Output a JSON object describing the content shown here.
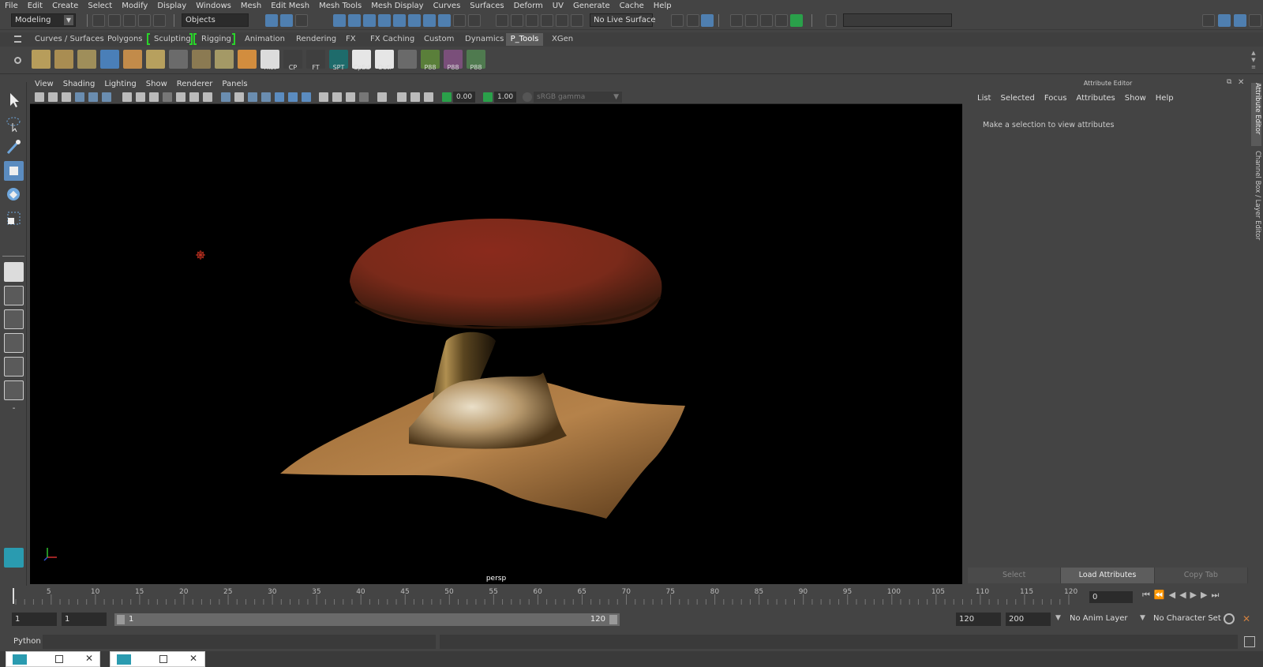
{
  "menubar": {
    "items": [
      "File",
      "Edit",
      "Create",
      "Select",
      "Modify",
      "Display",
      "Windows",
      "Mesh",
      "Edit Mesh",
      "Mesh Tools",
      "Mesh Display",
      "Curves",
      "Surfaces",
      "Deform",
      "UV",
      "Generate",
      "Cache",
      "Help"
    ]
  },
  "statusline": {
    "mode": "Modeling",
    "selection_mode": "Objects",
    "live_surface": "No Live Surface"
  },
  "shelf": {
    "tabs": [
      "Curves / Surfaces",
      "Polygons",
      "Sculpting",
      "Rigging",
      "Animation",
      "Rendering",
      "FX",
      "FX Caching",
      "Custom",
      "Dynamics",
      "P_Tools",
      "XGen"
    ],
    "active_tab": "P_Tools",
    "labels": [
      "Hist",
      "CP",
      "FT",
      "SPT",
      "CpEd",
      "Outl",
      "P88",
      "P88",
      "P88"
    ]
  },
  "viewport": {
    "menu": [
      "View",
      "Shading",
      "Lighting",
      "Show",
      "Renderer",
      "Panels"
    ],
    "exposure": "0.00",
    "gamma": "1.00",
    "color_space": "sRGB gamma",
    "camera": "persp"
  },
  "attribute_editor": {
    "title": "Attribute Editor",
    "menu": [
      "List",
      "Selected",
      "Focus",
      "Attributes",
      "Show",
      "Help"
    ],
    "message": "Make a selection to view attributes",
    "buttons": [
      "Select",
      "Load Attributes",
      "Copy Tab"
    ]
  },
  "side_tabs": [
    "Attribute Editor",
    "Channel Box / Layer Editor"
  ],
  "timeslider": {
    "ticks": [
      "5",
      "10",
      "15",
      "20",
      "25",
      "30",
      "35",
      "40",
      "45",
      "50",
      "55",
      "60",
      "65",
      "70",
      "75",
      "80",
      "85",
      "90",
      "95",
      "100",
      "105",
      "110",
      "115",
      "120"
    ],
    "current_frame": "0"
  },
  "range": {
    "start": "1",
    "playback_start": "1",
    "slider_start": "1",
    "slider_end": "120",
    "playback_end": "120",
    "end": "200",
    "anim_layer": "No Anim Layer",
    "character_set": "No Character Set"
  },
  "cmdline": {
    "language": "Python"
  },
  "colors": {
    "accent": "#5b8cc0",
    "bg": "#444444",
    "viewport_bg": "#000000"
  }
}
